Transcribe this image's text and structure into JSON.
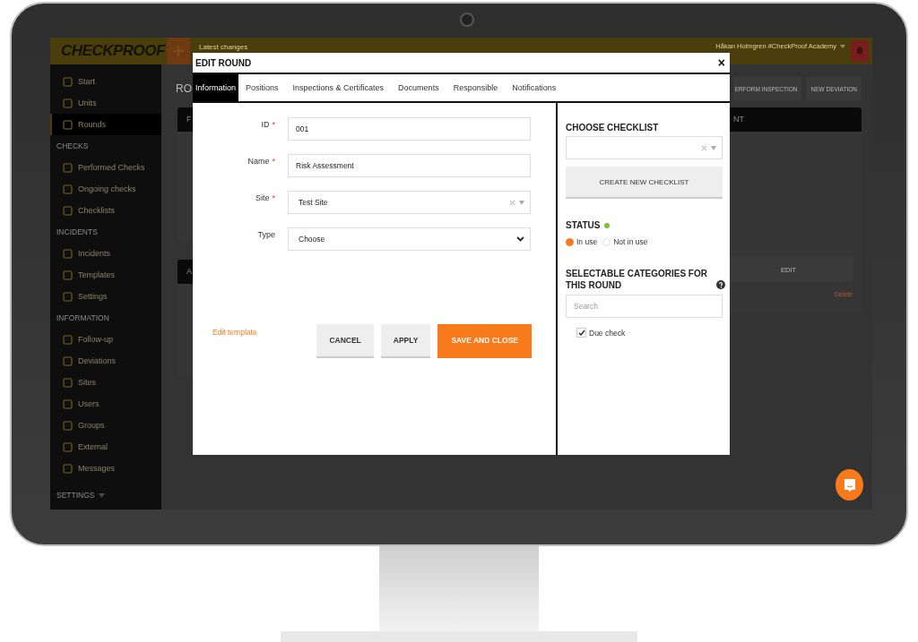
{
  "app": {
    "logo": "CHECKPROOF",
    "top_bar": {
      "latest_changes": "Latest changes",
      "user_menu": "Håkan Holmgren #CheckProof Academy"
    },
    "sidebar": {
      "items": [
        {
          "kind": "link",
          "label": "Start",
          "selected": false
        },
        {
          "kind": "link",
          "label": "Units",
          "selected": false
        },
        {
          "kind": "link",
          "label": "Rounds",
          "selected": true
        },
        {
          "kind": "section",
          "label": "CHECKS"
        },
        {
          "kind": "link",
          "label": "Performed Checks",
          "selected": false
        },
        {
          "kind": "link",
          "label": "Ongoing checks",
          "selected": false
        },
        {
          "kind": "link",
          "label": "Checklists",
          "selected": false
        },
        {
          "kind": "section",
          "label": "INCIDENTS"
        },
        {
          "kind": "link",
          "label": "Incidents",
          "selected": false
        },
        {
          "kind": "link",
          "label": "Templates",
          "selected": false
        },
        {
          "kind": "link",
          "label": "Settings",
          "selected": false
        },
        {
          "kind": "section",
          "label": "INFORMATION"
        },
        {
          "kind": "link",
          "label": "Follow-up",
          "selected": false
        },
        {
          "kind": "link",
          "label": "Deviations",
          "selected": false
        },
        {
          "kind": "link",
          "label": "Sites",
          "selected": false
        },
        {
          "kind": "link",
          "label": "Users",
          "selected": false
        },
        {
          "kind": "link",
          "label": "Groups",
          "selected": false
        },
        {
          "kind": "link",
          "label": "External",
          "selected": false
        },
        {
          "kind": "link",
          "label": "Messages",
          "selected": false
        },
        {
          "kind": "menu",
          "label": "SETTINGS"
        }
      ]
    },
    "page": {
      "title": "RO",
      "actions": [
        "ERFORM INSPECTION",
        "NEW DEVIATION"
      ],
      "left_cards": [
        "F",
        "A"
      ],
      "right_card": {
        "header": "NT",
        "button": "EDIT",
        "link": "Delete"
      }
    }
  },
  "modal": {
    "title": "EDIT ROUND",
    "close": "×",
    "tabs": [
      {
        "label": "Information",
        "selected": true
      },
      {
        "label": "Positions",
        "selected": false
      },
      {
        "label": "Inspections & Certificates",
        "selected": false
      },
      {
        "label": "Documents",
        "selected": false
      },
      {
        "label": "Responsible",
        "selected": false
      },
      {
        "label": "Notifications",
        "selected": false
      }
    ],
    "fields": [
      {
        "kind": "text",
        "label": "ID",
        "required_mark": "*",
        "value": "001"
      },
      {
        "kind": "text",
        "label": "Name",
        "required_mark": "*",
        "value": "Risk Assessment"
      },
      {
        "kind": "combo",
        "label": "Site",
        "required_mark": "*",
        "value": "Test Site"
      },
      {
        "kind": "select",
        "label": "Type",
        "value": "Choose"
      }
    ],
    "edit_template": "Edit template",
    "buttons": [
      {
        "kind": "default",
        "label": "CANCEL"
      },
      {
        "kind": "default",
        "label": "APPLY"
      },
      {
        "kind": "primary",
        "label": "SAVE AND CLOSE"
      }
    ],
    "checklist": {
      "heading": "CHOOSE CHECKLIST",
      "create_button": "CREATE NEW CHECKLIST"
    },
    "status": {
      "heading": "STATUS",
      "options": [
        {
          "label": "In use",
          "selected": true
        },
        {
          "label": "Not in use",
          "selected": false
        }
      ]
    },
    "categories": {
      "heading": "SELECTABLE CATEGORIES FOR THIS ROUND",
      "search_placeholder": "Search",
      "items": [
        {
          "label": "Due check",
          "checked": true
        }
      ]
    }
  }
}
